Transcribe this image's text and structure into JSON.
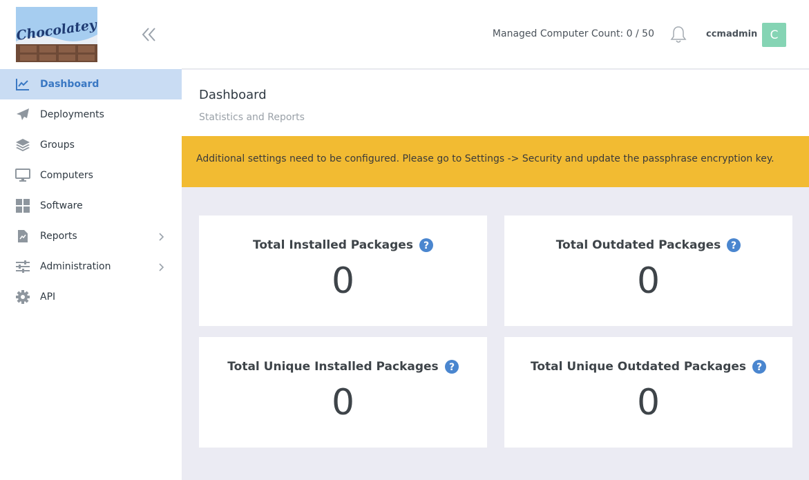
{
  "brand": {
    "logo_text": "Chocolatey"
  },
  "sidebar": {
    "items": [
      {
        "label": "Dashboard",
        "icon": "chart-line-icon",
        "active": true
      },
      {
        "label": "Deployments",
        "icon": "paper-plane-icon"
      },
      {
        "label": "Groups",
        "icon": "layers-icon"
      },
      {
        "label": "Computers",
        "icon": "desktop-icon"
      },
      {
        "label": "Software",
        "icon": "windows-icon"
      },
      {
        "label": "Reports",
        "icon": "report-file-icon",
        "has_submenu": true
      },
      {
        "label": "Administration",
        "icon": "sliders-icon",
        "has_submenu": true
      },
      {
        "label": "API",
        "icon": "gear-icon"
      }
    ]
  },
  "topbar": {
    "managed_count": "Managed Computer Count: 0 / 50",
    "username": "ccmadmin",
    "avatar_letter": "C"
  },
  "page": {
    "title": "Dashboard",
    "subtitle": "Statistics and Reports"
  },
  "alert": {
    "text": "Additional settings need to be configured. Please go to Settings -> Security and update the passphrase encryption key."
  },
  "stats": [
    {
      "title": "Total Installed Packages",
      "value": "0"
    },
    {
      "title": "Total Outdated Packages",
      "value": "0"
    },
    {
      "title": "Total Unique Installed Packages",
      "value": "0"
    },
    {
      "title": "Total Unique Outdated Packages",
      "value": "0"
    }
  ],
  "colors": {
    "accent": "#3a78c3",
    "active_bg": "#c9dcf3",
    "alert_bg": "#f2bb32",
    "avatar_bg": "#85d4b4",
    "help_icon": "#4a86cf"
  }
}
